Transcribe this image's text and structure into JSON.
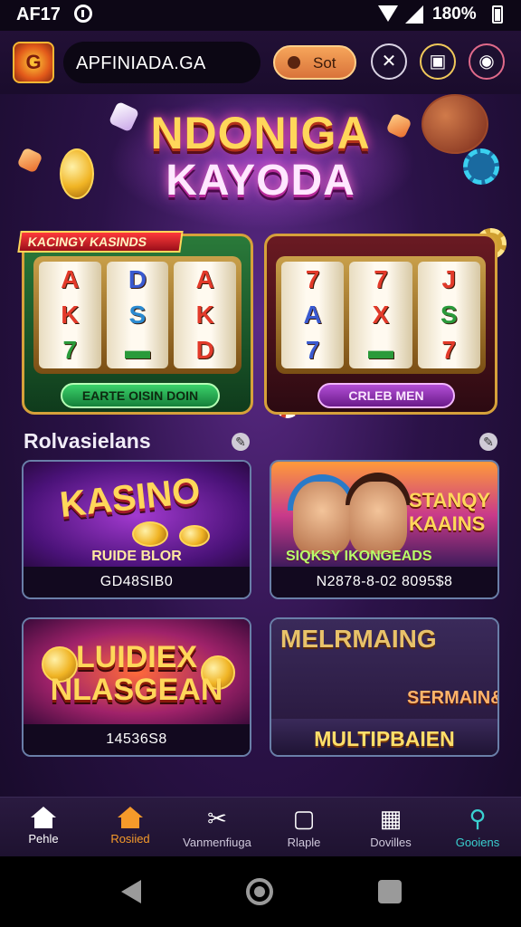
{
  "status_bar": {
    "time": "AF17",
    "battery": "180%"
  },
  "header": {
    "logo_letter": "G",
    "url": "APFINIADA.GA",
    "sot_label": "Sot"
  },
  "hero": {
    "title_line1": "NDONIGA",
    "title_line2": "KAYODA",
    "slot_left": {
      "tag": "KACINGY KASINDS",
      "reels": [
        [
          "A",
          "K",
          "7"
        ],
        [
          "D",
          "S",
          "▬"
        ],
        [
          "A",
          "K",
          "D"
        ]
      ],
      "button": "EARTE OISIN DOIN"
    },
    "slot_right": {
      "reels": [
        [
          "7",
          "A",
          "7"
        ],
        [
          "7",
          "X",
          "▬"
        ],
        [
          "J",
          "S",
          "7"
        ]
      ],
      "button": "CRLEB MEN"
    }
  },
  "section": {
    "title": "Rolvasielans"
  },
  "cards": [
    {
      "title": "KASINO",
      "subtitle": "RUIDE BLOR",
      "caption": "GD48SIB0"
    },
    {
      "title": "STANQY KAAINS",
      "subtitle": "SIQKSY IKONGEADS",
      "caption": "N2878-8-02 8095$8"
    },
    {
      "title": "LUIDIEX NLASGEAN",
      "caption": "14536S8"
    },
    {
      "title": "MELRMAING",
      "subtitle": "SERMAIN&",
      "caption": "MULTIPBAIEN"
    }
  ],
  "bottom_nav": [
    {
      "label": "Pehle",
      "icon": "home-icon"
    },
    {
      "label": "Rosiied",
      "icon": "house-accent-icon"
    },
    {
      "label": "Vanmenfiuga",
      "icon": "tools-icon"
    },
    {
      "label": "Rlaple",
      "icon": "square-icon"
    },
    {
      "label": "Dovilles",
      "icon": "grid-icon"
    },
    {
      "label": "Gooiens",
      "icon": "search-icon"
    }
  ],
  "colors": {
    "accent": "#f59a2a",
    "gold": "#ffd75a",
    "teal": "#3ad0d0"
  }
}
